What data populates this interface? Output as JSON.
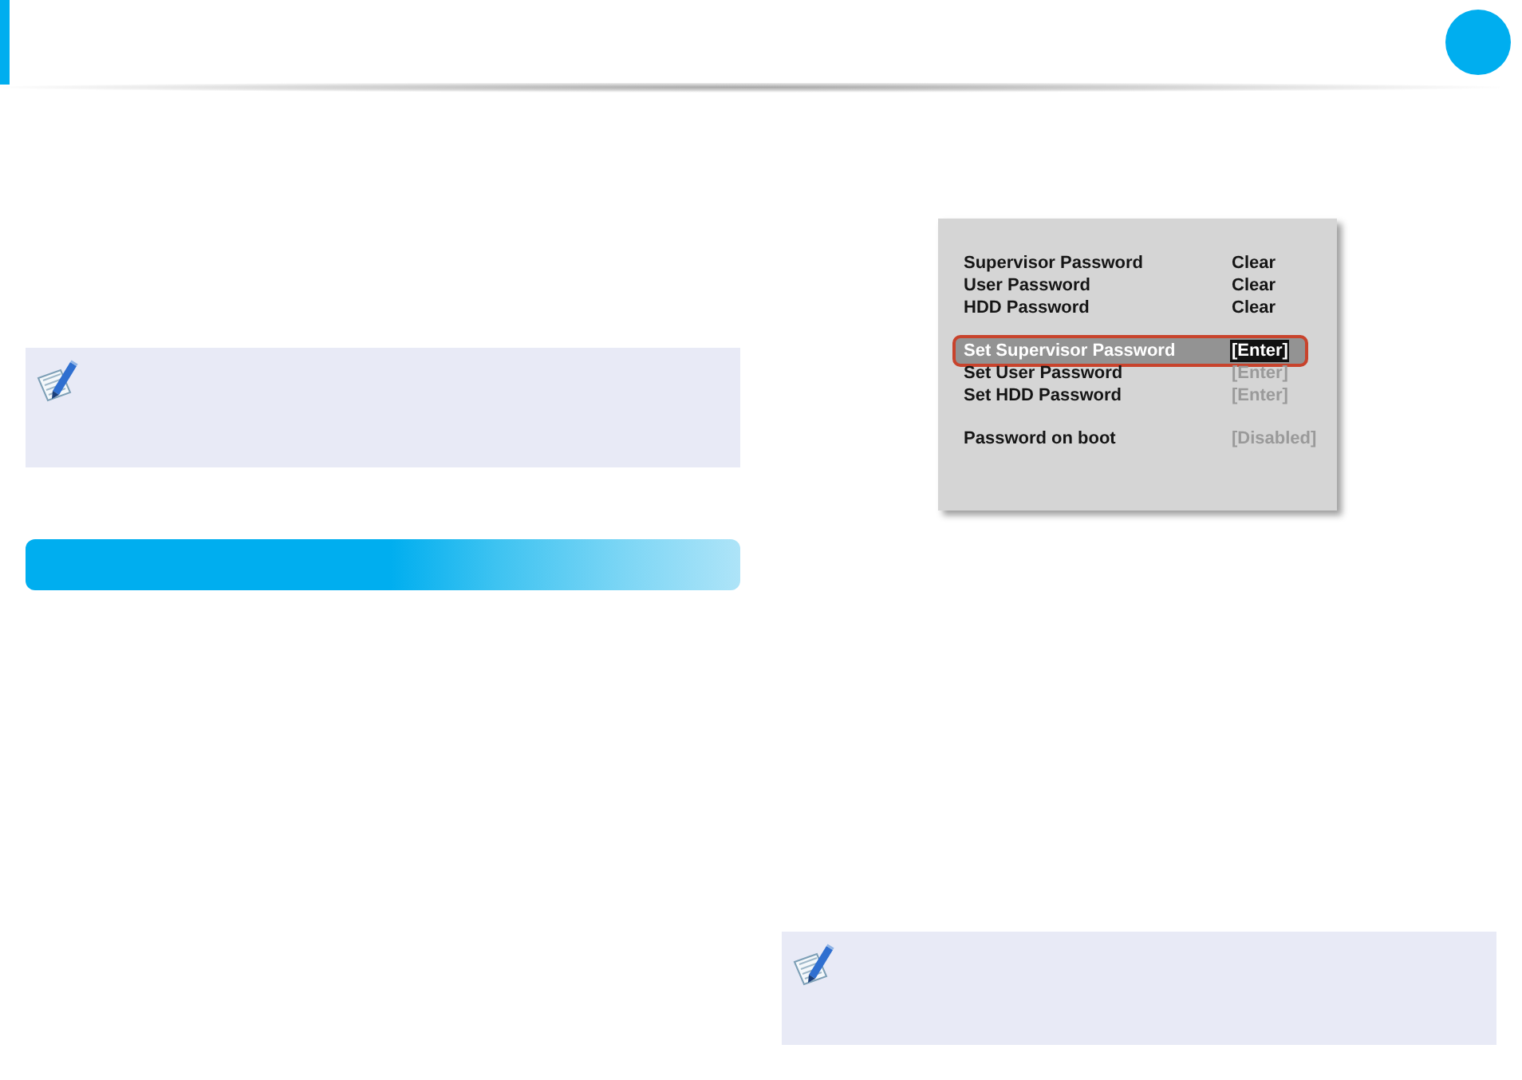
{
  "left_column": {
    "blocks": [
      {
        "kind": "note"
      },
      {
        "kind": "heading_bar"
      }
    ]
  },
  "right_column": {
    "blocks": [
      {
        "kind": "bios_screenshot",
        "groups": [
          {
            "rows": [
              {
                "label": "Supervisor Password",
                "value": "Clear",
                "selected": false,
                "disabled": false
              },
              {
                "label": "User Password",
                "value": "Clear",
                "selected": false,
                "disabled": false
              },
              {
                "label": "HDD Password",
                "value": "Clear",
                "selected": false,
                "disabled": false
              }
            ]
          },
          {
            "rows": [
              {
                "label": "Set Supervisor Password",
                "value": "[Enter]",
                "selected": true,
                "disabled": false
              },
              {
                "label": "Set User Password",
                "value": "[Enter]",
                "selected": false,
                "disabled": true
              },
              {
                "label": "Set HDD Password",
                "value": "[Enter]",
                "selected": false,
                "disabled": true
              }
            ]
          },
          {
            "rows": [
              {
                "label": "Password on boot",
                "value": "[Disabled]",
                "selected": false,
                "disabled": true
              }
            ]
          }
        ]
      },
      {
        "kind": "note"
      }
    ]
  }
}
